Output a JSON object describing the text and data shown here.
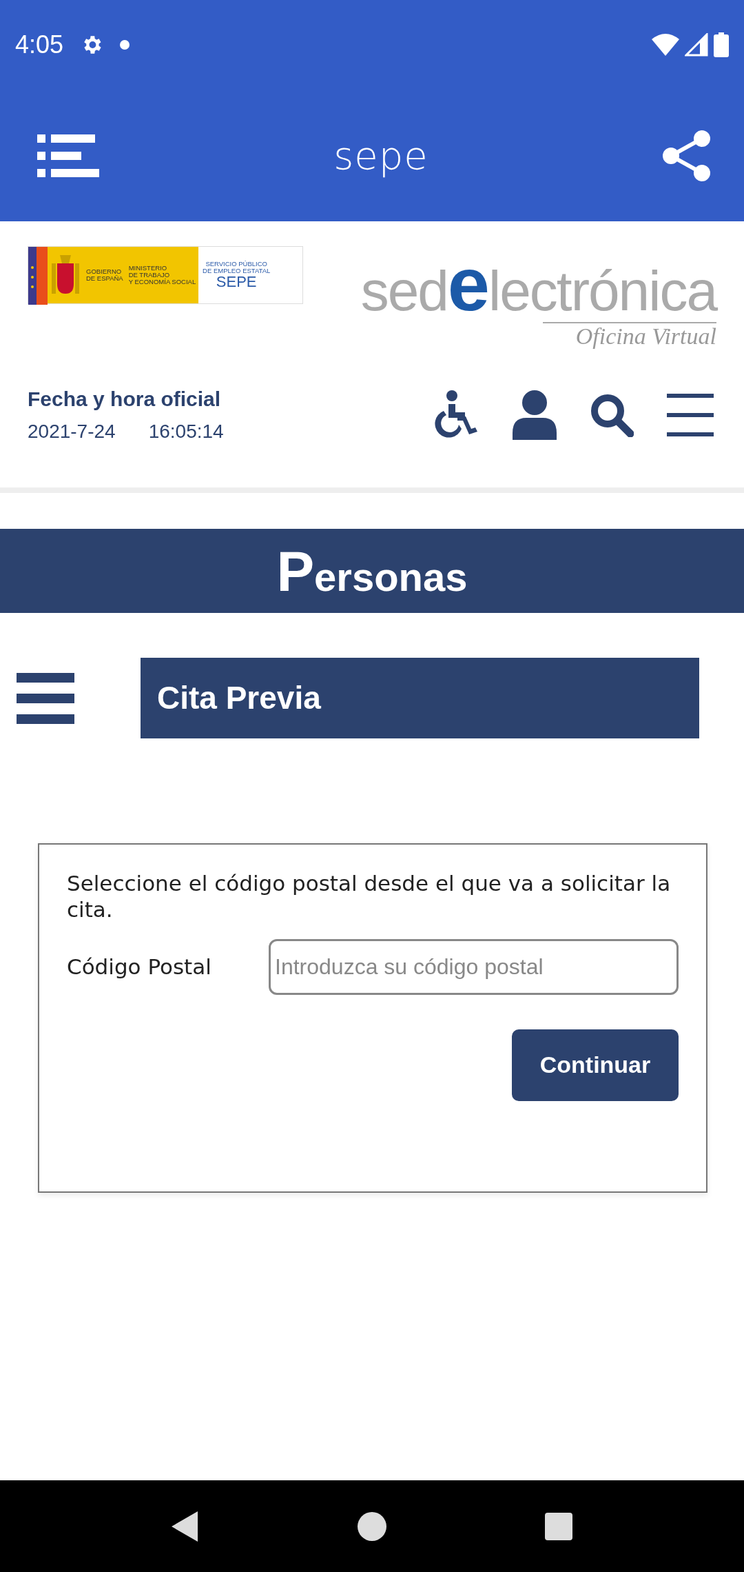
{
  "status_bar": {
    "time": "4:05"
  },
  "app_bar": {
    "title": "sepe"
  },
  "header": {
    "gov_logo": {
      "government": "GOBIERNO\nDE ESPAÑA",
      "ministry": "MINISTERIO\nDE TRABAJO\nY ECONOMÍA SOCIAL",
      "service": "SERVICIO PÚBLICO\nDE EMPLEO ESTATAL",
      "acronym": "SEPE"
    },
    "wordmark": {
      "parts": [
        "sed",
        "e",
        "lectrónica"
      ],
      "subtitle": "Oficina Virtual"
    },
    "clock": {
      "label": "Fecha y hora oficial",
      "date": "2021-7-24",
      "time": "16:05:14"
    }
  },
  "section_banner": {
    "title": "Personas"
  },
  "page_title": "Cita Previa",
  "form": {
    "instruction": "Seleccione el código postal desde el que va a solicitar la cita.",
    "field_label": "Código Postal",
    "placeholder": "Introduzca su código postal",
    "button": "Continuar"
  }
}
